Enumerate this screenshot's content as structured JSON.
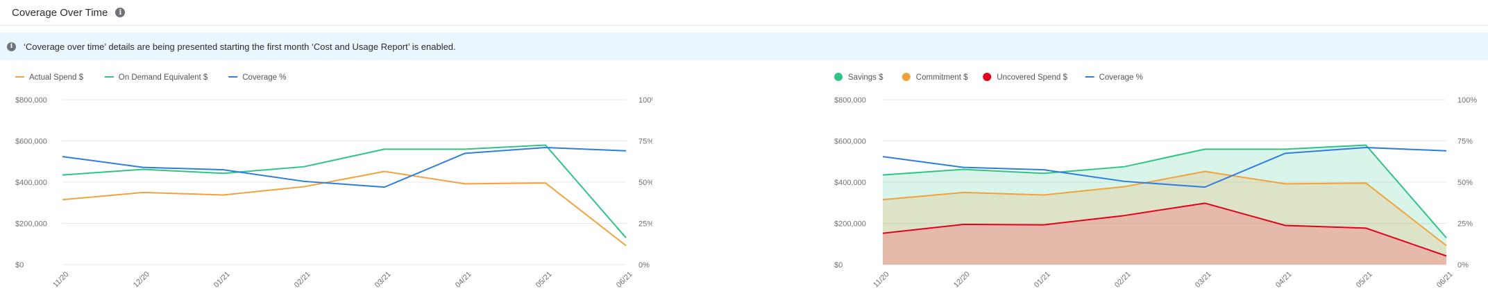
{
  "header": {
    "title": "Coverage Over Time",
    "info_icon": "info-icon"
  },
  "banner": {
    "icon": "info-icon",
    "text": "‘Coverage over time’ details are being presented starting the first month ‘Cost and Usage Report’ is enabled."
  },
  "colors": {
    "actual": "#f2a23a",
    "ondemand": "#2fc486",
    "coverage": "#2b7de0",
    "savings": "#2fc486",
    "commitment": "#f2a23a",
    "uncovered": "#e3001b",
    "grid": "#e8e8e8",
    "banner_bg": "#eaf6fd"
  },
  "chart_data": [
    {
      "type": "line",
      "categories": [
        "11/20",
        "12/20",
        "01/21",
        "02/21",
        "03/21",
        "04/21",
        "05/21",
        "06/21"
      ],
      "y_ticks": [
        "$0",
        "$200,000",
        "$400,000",
        "$600,000",
        "$800,000"
      ],
      "y2_ticks": [
        "0%",
        "25%",
        "50%",
        "75%",
        "100%"
      ],
      "ylim": [
        0,
        800000
      ],
      "y2lim": [
        0,
        100
      ],
      "grid": true,
      "legend_position": "top-left",
      "series": [
        {
          "name": "Actual Spend $",
          "axis": "left",
          "color": "#f2a23a",
          "marker": "line",
          "values": [
            315000,
            350000,
            338000,
            378000,
            452000,
            392000,
            396000,
            92000
          ]
        },
        {
          "name": "On Demand Equivalent $",
          "axis": "left",
          "color": "#2fc486",
          "marker": "line",
          "values": [
            435000,
            462000,
            443000,
            475000,
            560000,
            560000,
            580000,
            130000
          ]
        },
        {
          "name": "Coverage %",
          "axis": "right",
          "color": "#2b7de0",
          "marker": "line",
          "values": [
            65.5,
            59,
            57.5,
            50.5,
            47,
            67.5,
            71,
            69
          ]
        }
      ]
    },
    {
      "type": "area",
      "categories": [
        "11/20",
        "12/20",
        "01/21",
        "02/21",
        "03/21",
        "04/21",
        "05/21",
        "06/21"
      ],
      "y_ticks": [
        "$0",
        "$200,000",
        "$400,000",
        "$600,000",
        "$800,000"
      ],
      "y2_ticks": [
        "0%",
        "25%",
        "50%",
        "75%",
        "100%"
      ],
      "ylim": [
        0,
        800000
      ],
      "y2lim": [
        0,
        100
      ],
      "grid": true,
      "legend_position": "top-left",
      "series": [
        {
          "name": "Savings $",
          "axis": "left",
          "color": "#2fc486",
          "marker": "dot",
          "fill": "rgba(47,196,134,0.18)",
          "values": [
            435000,
            462000,
            443000,
            475000,
            560000,
            560000,
            580000,
            130000
          ]
        },
        {
          "name": "Commitment $",
          "axis": "left",
          "color": "#f2a23a",
          "marker": "dot",
          "fill": "rgba(242,162,58,0.20)",
          "values": [
            315000,
            350000,
            338000,
            378000,
            452000,
            392000,
            396000,
            92000
          ]
        },
        {
          "name": "Uncovered Spend $",
          "axis": "left",
          "color": "#e3001b",
          "marker": "dot",
          "fill": "rgba(244,120,130,0.38)",
          "values": [
            152000,
            195000,
            193000,
            238000,
            298000,
            190000,
            177000,
            42000
          ]
        },
        {
          "name": "Coverage %",
          "axis": "right",
          "color": "#2b7de0",
          "marker": "line",
          "values": [
            65.5,
            59,
            57.5,
            50.5,
            47,
            67.5,
            71,
            69
          ]
        }
      ]
    }
  ]
}
